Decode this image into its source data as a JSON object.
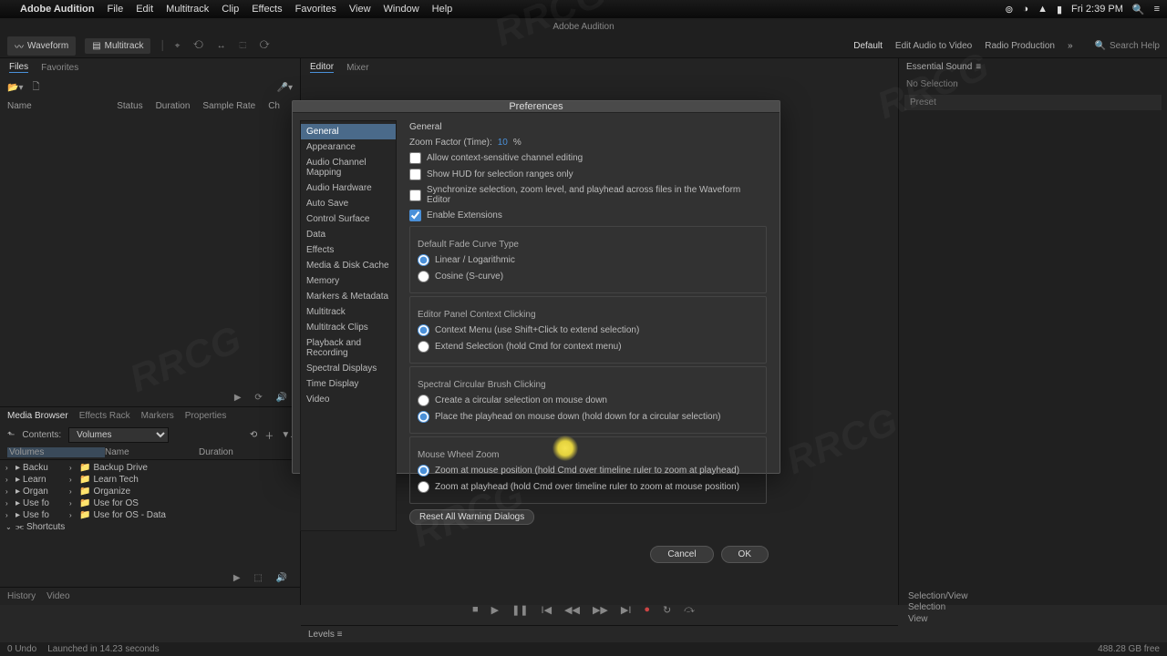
{
  "mac_menu": {
    "app_name": "Adobe Audition",
    "items": [
      "File",
      "Edit",
      "Multitrack",
      "Clip",
      "Effects",
      "Favorites",
      "View",
      "Window",
      "Help"
    ],
    "clock": "Fri 2:39 PM"
  },
  "app_subtitle": "Adobe Audition",
  "toolbar": {
    "waveform": "Waveform",
    "multitrack": "Multitrack",
    "workspaces": [
      "Default",
      "Edit Audio to Video",
      "Radio Production"
    ],
    "search_placeholder": "Search Help"
  },
  "left": {
    "tabs": [
      "Files",
      "Favorites"
    ],
    "cols": [
      "Name",
      "Status",
      "Duration",
      "Sample Rate",
      "Ch"
    ],
    "mb_tabs": [
      "Media Browser",
      "Effects Rack",
      "Markers",
      "Properties"
    ],
    "contents_label": "Contents:",
    "contents_value": "Volumes",
    "tree_col_hdr": [
      "Volumes",
      "Name",
      "Duration"
    ],
    "tree_left": [
      "Backu",
      "Learn",
      "Organ",
      "Use fo",
      "Use fo",
      "Shortcuts"
    ],
    "tree_right": [
      "Backup Drive",
      "Learn Tech",
      "Organize",
      "Use for OS",
      "Use for OS - Data"
    ],
    "history_tabs": [
      "History",
      "Video"
    ]
  },
  "center": {
    "tabs": [
      "Editor",
      "Mixer"
    ],
    "levels": "Levels"
  },
  "right": {
    "panel_title": "Essential Sound",
    "no_selection": "No Selection",
    "preset_label": "Preset"
  },
  "dialog": {
    "title": "Preferences",
    "categories": [
      "General",
      "Appearance",
      "Audio Channel Mapping",
      "Audio Hardware",
      "Auto Save",
      "Control Surface",
      "Data",
      "Effects",
      "Media & Disk Cache",
      "Memory",
      "Markers & Metadata",
      "Multitrack",
      "Multitrack Clips",
      "Playback and Recording",
      "Spectral Displays",
      "Time Display",
      "Video"
    ],
    "section": "General",
    "zoom_factor_label": "Zoom Factor (Time):",
    "zoom_factor_value": "10",
    "zoom_factor_unit": "%",
    "cb_context_edit": "Allow context-sensitive channel editing",
    "cb_hud": "Show HUD for selection ranges only",
    "cb_sync": "Synchronize selection, zoom level, and playhead across files in the Waveform Editor",
    "cb_ext": "Enable Extensions",
    "fade_title": "Default Fade Curve Type",
    "fade_linear": "Linear / Logarithmic",
    "fade_cosine": "Cosine (S-curve)",
    "ctx_title": "Editor Panel Context Clicking",
    "ctx_menu": "Context Menu (use Shift+Click to extend selection)",
    "ctx_extend": "Extend Selection (hold Cmd for context menu)",
    "brush_title": "Spectral Circular Brush Clicking",
    "brush_create": "Create a circular selection on mouse down",
    "brush_playhead": "Place the playhead on mouse down (hold down for a circular selection)",
    "wheel_title": "Mouse Wheel Zoom",
    "wheel_mouse": "Zoom at mouse position (hold Cmd over timeline ruler to zoom at playhead)",
    "wheel_playhead": "Zoom at playhead (hold Cmd over timeline ruler to zoom at mouse position)",
    "reset": "Reset All Warning Dialogs",
    "cancel": "Cancel",
    "ok": "OK"
  },
  "selview": {
    "title": "Selection/View",
    "rows": [
      "Selection",
      "View"
    ]
  },
  "status": {
    "undo": "0 Undo",
    "launched": "Launched in 14.23 seconds",
    "disk": "488.28 GB free"
  },
  "watermark": "RRCG"
}
